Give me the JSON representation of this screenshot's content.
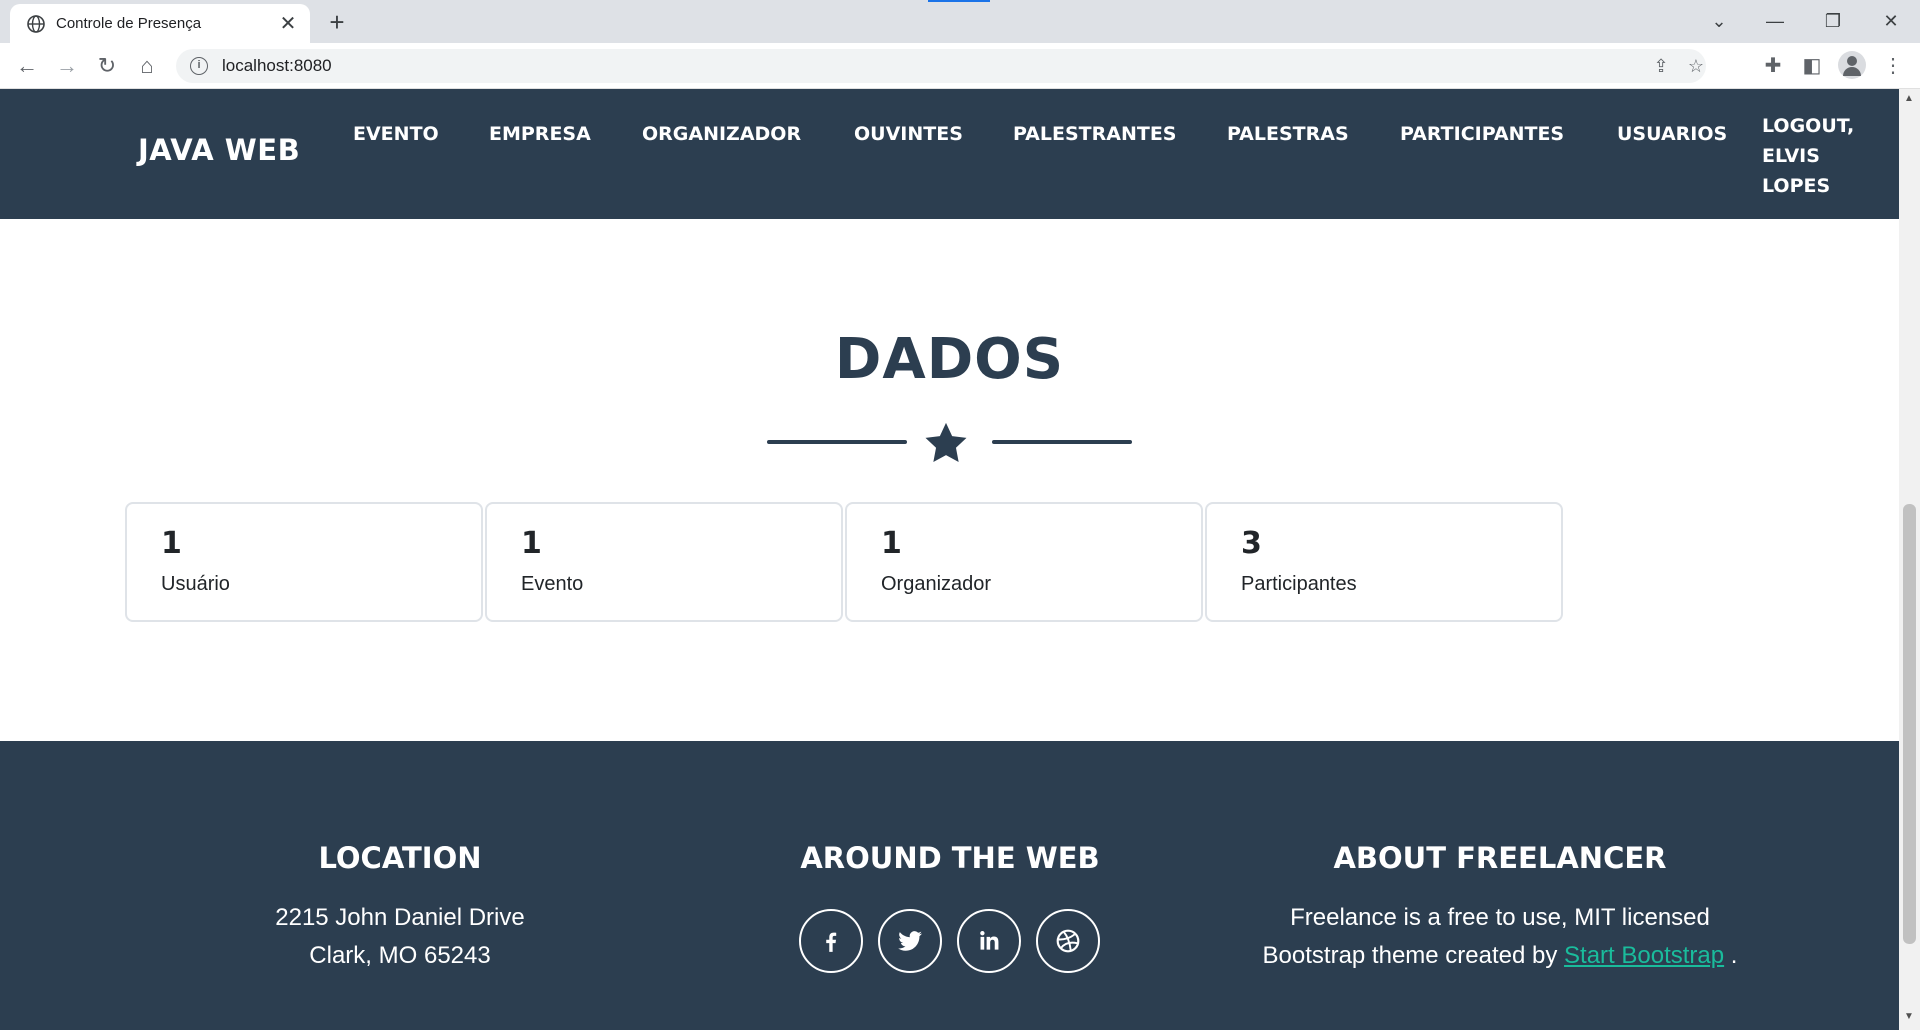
{
  "browser": {
    "tab_title": "Controle de Presença",
    "url": "localhost:8080"
  },
  "navbar": {
    "brand": "JAVA WEB",
    "links": [
      "EVENTO",
      "EMPRESA",
      "ORGANIZADOR",
      "OUVINTES",
      "PALESTRANTES",
      "PALESTRAS",
      "PARTICIPANTES",
      "USUARIOS"
    ],
    "logout": [
      "LOGOUT,",
      "ELVIS",
      "LOPES"
    ]
  },
  "main": {
    "title": "DADOS",
    "cards": [
      {
        "value": "1",
        "label": "Usuário"
      },
      {
        "value": "1",
        "label": "Evento"
      },
      {
        "value": "1",
        "label": "Organizador"
      },
      {
        "value": "3",
        "label": "Participantes"
      }
    ]
  },
  "footer": {
    "location": {
      "title": "LOCATION",
      "line1": "2215 John Daniel Drive",
      "line2": "Clark, MO 65243"
    },
    "web": {
      "title": "AROUND THE WEB",
      "icons": [
        "facebook-icon",
        "twitter-icon",
        "linkedin-icon",
        "dribbble-icon"
      ]
    },
    "about": {
      "title": "ABOUT FREELANCER",
      "line1": "Freelance is a free to use, MIT licensed",
      "line2_prefix": "Bootstrap theme created by ",
      "link": "Start Bootstrap",
      "line2_suffix": "."
    }
  },
  "colors": {
    "primary": "#2c3e50",
    "accent": "#1abc9c"
  }
}
